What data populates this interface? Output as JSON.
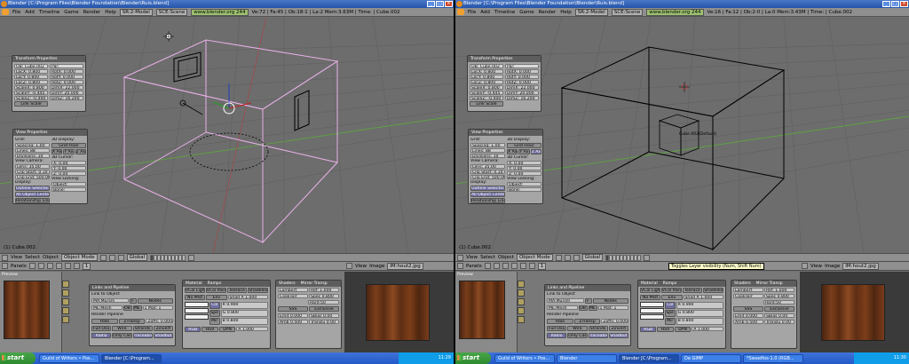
{
  "left": {
    "title": "Blender [C:\\Program Files\\Blender Foundation\\Blender\\Ruis.blend]",
    "menu": [
      "File",
      "Add",
      "Timeline",
      "Game",
      "Render",
      "Help"
    ],
    "screen_field": "SR:2-Model",
    "scene_field": "SCE:Scene",
    "url": "www.blender.org 244",
    "stats": "Ve:72 | Fa:45 | Ob:18-1 | La:2  Mem:3.63M | Time: | Cube.002",
    "transform": {
      "title": "Transform Properties",
      "ob_name": "OB: Cube.002",
      "par": "Par:",
      "left_fields": [
        "LocX: 0.800",
        "LocY: 0.800",
        "LocZ: 0.800",
        "ScaleX: 0.800",
        "ScaleY: -0.445",
        "ScaleZ: -0.400"
      ],
      "right_fields": [
        "RotX: 0.000",
        "RotY: 0.000",
        "RotZ: 0.000",
        "DimX: 22.000",
        "DimY: 20.000",
        "DimZ: 16.200"
      ],
      "link_scale": "Link Scale"
    },
    "view": {
      "title": "View Properties",
      "grid_label": "Grid:",
      "grid_fields": [
        "Spacing: 1.00",
        "Lines: 88",
        "Divisions: 10"
      ],
      "view_camera_label": "View Camera:",
      "camera_fields": [
        "Lens: 35.00",
        "Clip Start: 0.10",
        "Clip End: 500.00"
      ],
      "display_label": "Display:",
      "display_buttons": [
        "Outline Selected",
        "All Object Centers",
        "Relationship Lines"
      ],
      "display3d_label": "3D Display:",
      "grid_floor": "Grid Floor",
      "axes": [
        "X Axis",
        "Y Axis",
        "Z Axis"
      ],
      "cursor_label": "3D Cursor:",
      "cursor_fields": [
        "X: 0.00",
        "Y: 0.00",
        "Z: 0.00"
      ],
      "view_locking_label": "View Locking:",
      "locking_fields": [
        "Object:",
        "Bone:"
      ]
    },
    "object_label": "(1) Cube.002",
    "header3d": {
      "menu": [
        "View",
        "Select",
        "Object"
      ],
      "mode": "Object Mode",
      "orient": "Global"
    },
    "header_buttons": {
      "label": "Panels",
      "number": "1"
    },
    "preview_title": "Preview",
    "links": {
      "title": "Links and Pipeline",
      "link_to_object": "Link to Object",
      "ma_field": "MA:Mursm",
      "me_field": "ME:Mesh",
      "ob_field": "OB",
      "me_label": "ME",
      "f_label": "F",
      "nodes": "Nodes",
      "mat_count": "1 Mat: 1",
      "render_pipeline": "Render Pipeline",
      "pipeline_buttons": [
        "Halo",
        "ZTransp",
        "Zoffs: 0.000",
        "Full Osa",
        "Wire",
        "Strands",
        "Zinvert",
        "Radio",
        "Only Cast",
        "Traceable",
        "Shadbut"
      ]
    },
    "material": {
      "title": "Material",
      "tab2": "Ramps",
      "buttons": [
        "VCol Light",
        "VCol Paint",
        "TexFace",
        "Shadeless",
        "No Mist",
        "Env",
        "Shad A 1.000"
      ],
      "col_labels": [
        "Col",
        "Spe",
        "Mir"
      ],
      "rgb": [
        "R 0.900",
        "G 0.800",
        "B 0.800"
      ],
      "modes": [
        "RGB",
        "HSV",
        "DYN",
        "A 1.000"
      ]
    },
    "shaders": {
      "title": "Shaders",
      "tab2": "Mirror Transp",
      "lambert": "Lambert",
      "ref": "Ref: 1.000",
      "cooktorr": "CookTorr",
      "spec": "Spec 0.800",
      "hard": "Hard:50",
      "sss": "SSS",
      "emit": "Emit 0.000",
      "amb": "Amb 0.500",
      "tralu": "Tralu 0.00",
      "exclusive": "Exclusive",
      "shadow": "Shadow",
      "sbias": "SBias 0.00",
      "translucency": "Translu 0.00"
    },
    "image_header": {
      "menu": [
        "View",
        "Image"
      ],
      "image": "IM:hout2.jpg"
    }
  },
  "right": {
    "title": "Blender [C:\\Program Files\\Blender Foundation\\Blender\\Ruis.blend]",
    "menu": [
      "File",
      "Add",
      "Timeline",
      "Game",
      "Render",
      "Help"
    ],
    "screen_field": "SR:2-Model",
    "scene_field": "SCE:Scene",
    "url": "www.blender.org 244",
    "stats": "Ve:16 | Fa:12 | Ob:2-0 | La:0  Mem:3.43M | Time: | Cube.002",
    "object_label": "(1) Cube.002",
    "cube_label": "Cube.002(Default)",
    "tooltip": "Toggles Layer visibility (Num, Shift Num)"
  },
  "taskbar": {
    "start": "start",
    "items_left": [
      "Guild of Writers • Pos...",
      "Blender [C:\\Program..."
    ],
    "items_right": [
      "Guild of Writers • Pos...",
      "Blender",
      "Blender [C:\\Program...",
      "De GIMP",
      "*Swaelfos-1.0 (RGB..."
    ],
    "clock_left": "11:29",
    "clock_right": "11:30"
  },
  "colors": {
    "viewport_bg": "#6d6d6d",
    "grid_line": "#606060",
    "axis_green": "#5ca83c",
    "axis_red": "#b04040",
    "selected_outline": "#e8b0e8",
    "object_wire": "#000000"
  }
}
